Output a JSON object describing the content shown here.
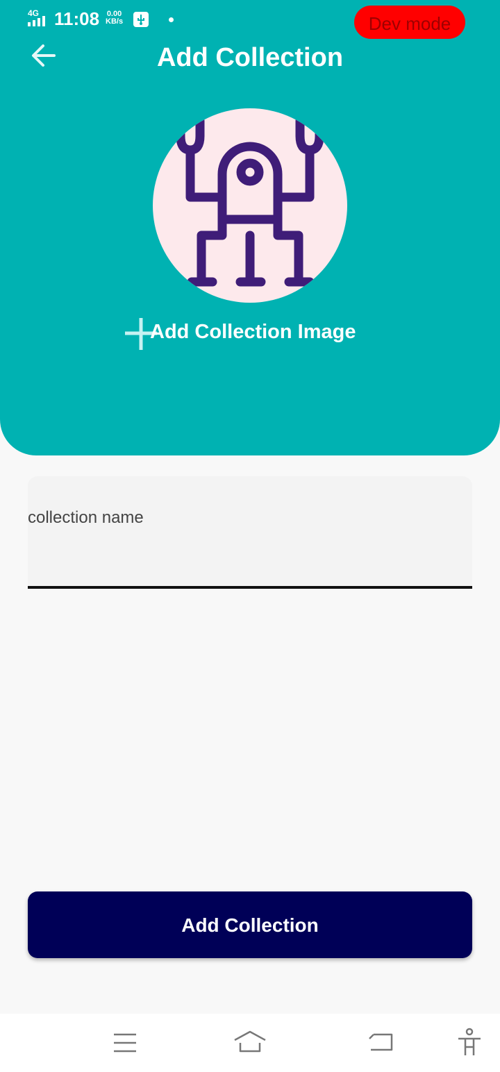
{
  "status_bar": {
    "network": "4G",
    "time": "11:08",
    "speed_value": "0.00",
    "speed_unit": "KB/s",
    "icons": [
      "signal-icon",
      "usb-icon",
      "notification-dot-icon"
    ]
  },
  "dev_badge": "Dev mode",
  "header": {
    "title": "Add Collection",
    "back_icon": "arrow-left-icon",
    "avatar_icon": "robot-icon",
    "add_image_label": "Add Collection Image",
    "add_image_icon": "plus-icon"
  },
  "form": {
    "collection_name_placeholder": "collection name",
    "collection_name_value": ""
  },
  "submit_label": "Add Collection",
  "nav_bar": {
    "icons": [
      "menu-icon",
      "home-icon",
      "back-icon",
      "accessibility-icon"
    ]
  },
  "colors": {
    "header": "#00b2b2",
    "button": "#000057",
    "dev_badge": "#ff0000",
    "avatar_bg": "#fde9ec",
    "robot": "#3f1d78",
    "background": "#f8f8f8"
  }
}
